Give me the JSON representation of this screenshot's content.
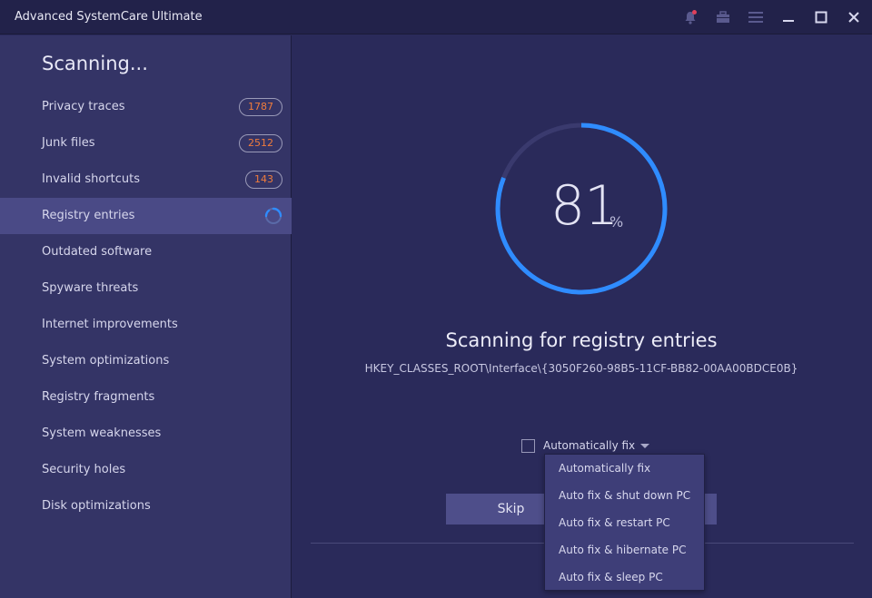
{
  "window": {
    "title": "Advanced SystemCare Ultimate"
  },
  "titlebar_icons": [
    "bell-icon",
    "toolbox-icon",
    "menu-icon",
    "minimize-icon",
    "maximize-icon",
    "close-icon"
  ],
  "sidebar": {
    "heading": "Scanning...",
    "items": [
      {
        "label": "Privacy traces",
        "badge": "1787"
      },
      {
        "label": "Junk files",
        "badge": "2512"
      },
      {
        "label": "Invalid shortcuts",
        "badge": "143"
      },
      {
        "label": "Registry entries",
        "status": "scanning"
      },
      {
        "label": "Outdated software"
      },
      {
        "label": "Spyware threats"
      },
      {
        "label": "Internet improvements"
      },
      {
        "label": "System optimizations"
      },
      {
        "label": "Registry fragments"
      },
      {
        "label": "System weaknesses"
      },
      {
        "label": "Security holes"
      },
      {
        "label": "Disk optimizations"
      }
    ]
  },
  "progress": {
    "value": "81",
    "unit": "%",
    "fraction": 0.81
  },
  "scan": {
    "title": "Scanning for registry entries",
    "path": "HKEY_CLASSES_ROOT\\Interface\\{3050F260-98B5-11CF-BB82-00AA00BDCE0B}"
  },
  "autofix": {
    "label": "Automatically fix",
    "checked": false,
    "options": [
      "Automatically fix",
      "Auto fix & shut down PC",
      "Auto fix & restart PC",
      "Auto fix & hibernate PC",
      "Auto fix & sleep PC"
    ]
  },
  "buttons": {
    "skip": "Skip"
  },
  "colors": {
    "accent": "#2f8cff",
    "badge_text": "#f07c3c",
    "sidebar_bg": "#343466",
    "main_bg": "#2a2a5a",
    "active_item": "#4a4a86"
  }
}
